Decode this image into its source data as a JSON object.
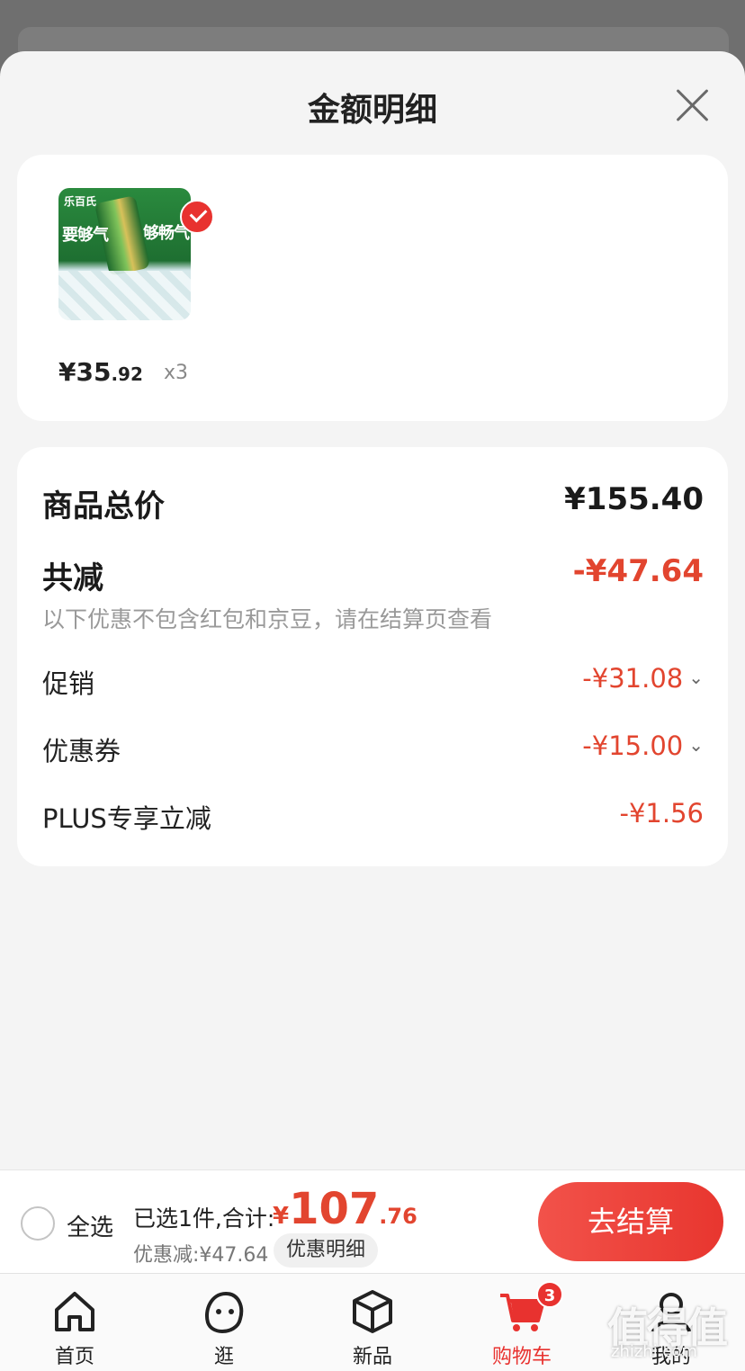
{
  "sheet": {
    "title": "金额明细"
  },
  "product": {
    "brand": "乐百氏",
    "image_text_left": "要够气",
    "image_text_right": "够畅气",
    "price_int": "¥35",
    "price_dec": ".92",
    "qty": "x3"
  },
  "detail": {
    "total_label": "商品总价",
    "total_value": "¥155.40",
    "reduce_label": "共减",
    "reduce_value": "-¥47.64",
    "note": "以下优惠不包含红包和京豆，请在结算页查看",
    "promo_label": "促销",
    "promo_value": "-¥31.08",
    "coupon_label": "优惠券",
    "coupon_value": "-¥15.00",
    "plus_label": "PLUS专享立减",
    "plus_value": "-¥1.56"
  },
  "checkout": {
    "select_all": "全选",
    "summary": "已选1件,合计:",
    "total_cur": "¥",
    "total_int": "107",
    "total_dec": ".76",
    "discount": "优惠减:¥47.64",
    "detail_link": "优惠明细",
    "button": "去结算"
  },
  "tabs": [
    {
      "label": "首页",
      "icon": "home-icon"
    },
    {
      "label": "逛",
      "icon": "face-icon"
    },
    {
      "label": "新品",
      "icon": "cube-icon"
    },
    {
      "label": "购物车",
      "icon": "cart-icon",
      "badge": "3",
      "active": true
    },
    {
      "label": "我的",
      "icon": "user-icon"
    }
  ],
  "watermark": {
    "glyphs": "值得值",
    "domain": "zhizhi.com"
  },
  "colors": {
    "accent": "#e8322f",
    "discount": "#e2452f",
    "sheet_bg": "#f4f4f4"
  }
}
